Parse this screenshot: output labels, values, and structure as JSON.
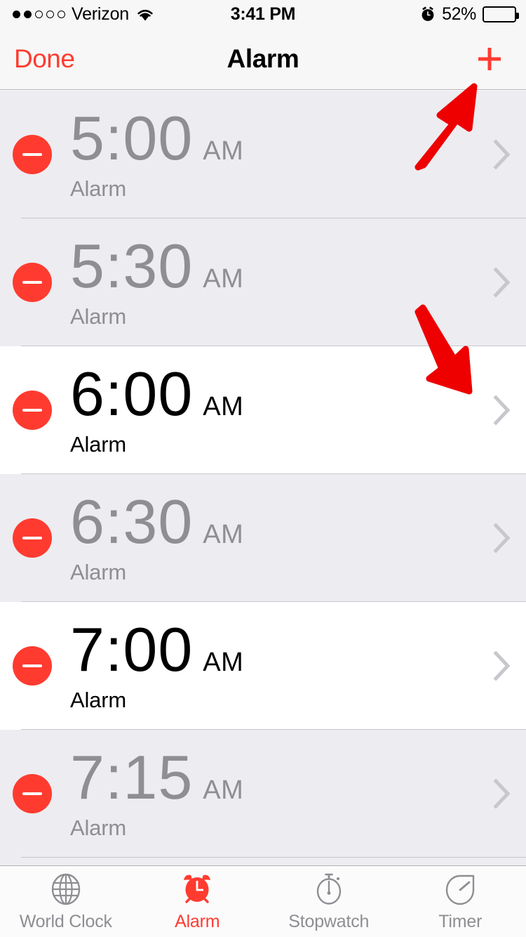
{
  "status_bar": {
    "signal_dots_filled": 2,
    "signal_dots_total": 5,
    "carrier": "Verizon",
    "wifi_icon": "wifi-icon",
    "time": "3:41 PM",
    "alarm_icon": "alarm-clock-icon",
    "battery_percent": "52%",
    "battery_level": 52
  },
  "nav_bar": {
    "left_button": "Done",
    "title": "Alarm",
    "add_button_icon": "plus-icon"
  },
  "alarms": [
    {
      "time": "5:00",
      "period": "AM",
      "label": "Alarm",
      "enabled": false,
      "delete_icon": "minus-circle-icon",
      "chevron_icon": "chevron-right-icon"
    },
    {
      "time": "5:30",
      "period": "AM",
      "label": "Alarm",
      "enabled": false,
      "delete_icon": "minus-circle-icon",
      "chevron_icon": "chevron-right-icon"
    },
    {
      "time": "6:00",
      "period": "AM",
      "label": "Alarm",
      "enabled": true,
      "delete_icon": "minus-circle-icon",
      "chevron_icon": "chevron-right-icon"
    },
    {
      "time": "6:30",
      "period": "AM",
      "label": "Alarm",
      "enabled": false,
      "delete_icon": "minus-circle-icon",
      "chevron_icon": "chevron-right-icon"
    },
    {
      "time": "7:00",
      "period": "AM",
      "label": "Alarm",
      "enabled": true,
      "delete_icon": "minus-circle-icon",
      "chevron_icon": "chevron-right-icon"
    },
    {
      "time": "7:15",
      "period": "AM",
      "label": "Alarm",
      "enabled": false,
      "delete_icon": "minus-circle-icon",
      "chevron_icon": "chevron-right-icon"
    }
  ],
  "tab_bar": {
    "items": [
      {
        "label": "World Clock",
        "icon": "globe-icon",
        "active": false
      },
      {
        "label": "Alarm",
        "icon": "alarm-clock-icon",
        "active": true
      },
      {
        "label": "Stopwatch",
        "icon": "stopwatch-icon",
        "active": false
      },
      {
        "label": "Timer",
        "icon": "timer-icon",
        "active": false
      }
    ]
  },
  "annotations": [
    {
      "name": "arrow-to-add-button",
      "direction": "up-right",
      "color": "#ee0000"
    },
    {
      "name": "arrow-to-alarm-detail-chevron",
      "direction": "down-right",
      "color": "#ee0000"
    }
  ],
  "colors": {
    "accent_red": "#ff3b30",
    "annotation_red": "#ee0000",
    "row_off_bg": "#edecf0",
    "row_on_bg": "#ffffff",
    "disabled_text": "#8e8e93",
    "separator": "#c8c7cc",
    "chevron": "#c7c7cc"
  }
}
